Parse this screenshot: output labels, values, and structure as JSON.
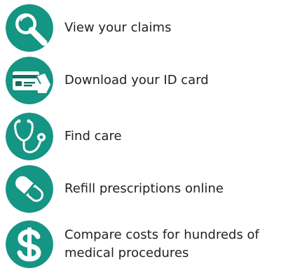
{
  "colors": {
    "accent": "#159583",
    "accent_dark": "#0f6f62",
    "icon_fg": "#ffffff",
    "text": "#222222"
  },
  "features": [
    {
      "label": "View your claims",
      "icon": "magnifier-icon"
    },
    {
      "label": "Download your ID card",
      "icon": "id-card-icon"
    },
    {
      "label": "Find care",
      "icon": "stethoscope-icon"
    },
    {
      "label": "Refill prescriptions online",
      "icon": "capsule-icon"
    },
    {
      "label": "Compare costs for hundreds of medical procedures",
      "icon": "dollar-icon"
    }
  ]
}
